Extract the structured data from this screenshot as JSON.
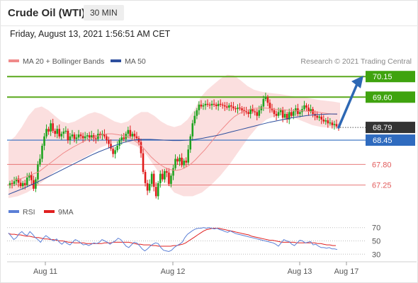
{
  "header": {
    "title": "Crude Oil (WTI)",
    "timeframe": "30 MIN"
  },
  "datetime": "Friday, August 13, 2021 1:56:51 AM CET",
  "legend": {
    "ma20_label": "MA 20 + Bollinger Bands",
    "ma50_label": "MA 50",
    "credit": "Research © 2021 Trading Central"
  },
  "rsi_legend": {
    "rsi_label": "RSI",
    "ma9_label": "9MA"
  },
  "colors": {
    "support": "#3a6fc4",
    "resistance": "#5aa81d",
    "target_box": "#3fa30f",
    "current_box": "#333333",
    "pivot": "#2f6bbf",
    "red_level": "#e25b5b",
    "bollinger": "#f9d4d4",
    "ma20": "#f08a8a",
    "ma50": "#2d4f9e",
    "candle_up": "#1ea31e",
    "candle_down": "#e01b1b",
    "rsi": "#5b7fd6",
    "rsi_ma9": "#e02020",
    "arrow": "#2d68b4"
  },
  "chart_data": [
    {
      "type": "candlestick",
      "title": "Crude Oil (WTI)",
      "timeframe": "30 MIN",
      "x_tick_labels": [
        "Aug 11",
        "Aug 12",
        "Aug 13",
        "Aug 17"
      ],
      "ylim": [
        66.9,
        70.4
      ],
      "grid": false,
      "legend_position": "top-left",
      "levels": [
        {
          "value": 70.15,
          "label": "70.15",
          "kind": "target"
        },
        {
          "value": 69.6,
          "label": "69.60",
          "kind": "resistance"
        },
        {
          "value": 68.79,
          "label": "68.79",
          "kind": "current"
        },
        {
          "value": 68.45,
          "label": "68.45",
          "kind": "pivot"
        },
        {
          "value": 67.8,
          "label": "67.80",
          "kind": "support"
        },
        {
          "value": 67.25,
          "label": "67.25",
          "kind": "support"
        }
      ],
      "closes": [
        67.3,
        67.28,
        67.35,
        67.42,
        67.31,
        67.22,
        67.3,
        67.25,
        67.45,
        67.52,
        67.38,
        67.15,
        67.4,
        67.8,
        67.95,
        68.3,
        68.55,
        68.75,
        68.68,
        68.9,
        68.7,
        68.62,
        68.75,
        68.55,
        68.62,
        68.68,
        68.7,
        68.45,
        68.55,
        68.6,
        68.48,
        68.52,
        68.6,
        68.56,
        68.5,
        68.55,
        68.58,
        68.52,
        68.58,
        68.5,
        68.48,
        68.62,
        68.58,
        68.62,
        68.55,
        68.45,
        68.35,
        68.22,
        68.08,
        68.18,
        68.3,
        68.45,
        68.52,
        68.48,
        68.62,
        68.72,
        68.55,
        68.62,
        68.55,
        68.5,
        68.4,
        68.1,
        67.6,
        67.3,
        67.1,
        67.28,
        67.55,
        67.2,
        66.95,
        67.3,
        67.55,
        67.4,
        67.62,
        67.58,
        67.28,
        67.5,
        67.7,
        67.95,
        67.88,
        67.98,
        67.78,
        67.9,
        67.85,
        68.2,
        68.55,
        68.9,
        69.1,
        69.25,
        69.4,
        69.35,
        69.38,
        69.42,
        69.4,
        69.38,
        69.42,
        69.4,
        69.36,
        69.42,
        69.4,
        69.38,
        69.35,
        69.32,
        69.38,
        69.35,
        69.3,
        69.28,
        69.32,
        69.3,
        69.25,
        69.22,
        69.2,
        69.15,
        69.28,
        69.22,
        69.2,
        69.1,
        69.25,
        69.35,
        69.55,
        69.6,
        69.45,
        69.3,
        69.25,
        69.15,
        69.1,
        69.2,
        69.25,
        69.05,
        69.15,
        69.0,
        69.2,
        69.1,
        69.22,
        69.3,
        69.15,
        69.2,
        69.28,
        69.38,
        69.32,
        69.22,
        69.28,
        69.15,
        69.1,
        69.05,
        69.08,
        69.0,
        68.95,
        68.98,
        68.9,
        68.92,
        68.85,
        68.88,
        68.82,
        68.79
      ],
      "ma20": [
        67.4,
        67.4,
        67.45,
        67.5,
        67.55,
        67.6,
        67.7,
        67.8,
        67.9,
        68.0,
        68.1,
        68.18,
        68.26,
        68.33,
        68.4,
        68.46,
        68.52,
        68.56,
        68.6,
        68.62,
        68.62,
        68.6,
        68.58,
        68.54,
        68.48,
        68.4,
        68.3,
        68.15,
        68.0,
        67.88,
        67.78,
        67.7,
        67.66,
        67.64,
        67.66,
        67.72,
        67.8,
        67.92,
        68.06,
        68.2,
        68.36,
        68.52,
        68.68,
        68.82,
        68.96,
        69.08,
        69.16,
        69.22,
        69.27,
        69.3,
        69.31,
        69.31,
        69.3,
        69.28,
        69.27,
        69.26,
        69.25,
        69.24,
        69.24,
        69.23,
        69.22,
        69.21,
        69.2,
        69.18,
        69.16,
        69.15,
        69.14
      ],
      "bollinger_upper": [
        68.4,
        68.55,
        68.8,
        69.1,
        69.3,
        69.35,
        69.25,
        69.1,
        68.95,
        68.9,
        68.95,
        69.05,
        69.15,
        69.2,
        69.15,
        69.05,
        68.95,
        68.9,
        68.95,
        69.1,
        69.2,
        69.2,
        69.1,
        68.95,
        68.85,
        68.8,
        68.85,
        69.0,
        69.25,
        69.6,
        69.8,
        69.95,
        70.1,
        70.2,
        70.18,
        70.05,
        69.9,
        69.8,
        69.75,
        69.72,
        69.7,
        69.68,
        69.65,
        69.62,
        69.6,
        69.58,
        69.55,
        69.52,
        69.5,
        69.48,
        69.45
      ],
      "bollinger_lower": [
        66.9,
        66.95,
        67.05,
        67.2,
        67.4,
        67.6,
        67.75,
        67.85,
        67.95,
        68.1,
        68.25,
        68.35,
        68.4,
        68.38,
        68.28,
        68.05,
        67.7,
        67.35,
        67.05,
        66.95,
        66.95,
        67.05,
        67.25,
        67.5,
        67.8,
        68.15,
        68.5,
        68.8,
        69.0,
        69.1,
        69.15,
        69.05,
        68.95,
        68.85,
        68.8,
        68.78,
        68.8
      ],
      "ma50": [
        67.0,
        67.08,
        67.16,
        67.25,
        67.34,
        67.44,
        67.54,
        67.64,
        67.74,
        67.84,
        67.94,
        68.04,
        68.13,
        68.21,
        68.29,
        68.36,
        68.42,
        68.46,
        68.47,
        68.47,
        68.46,
        68.45,
        68.44,
        68.44,
        68.45,
        68.47,
        68.5,
        68.54,
        68.58,
        68.63,
        68.68,
        68.73,
        68.78,
        68.83,
        68.88,
        68.93,
        68.97,
        69.01,
        69.05,
        69.08,
        69.11,
        69.13,
        69.14,
        69.15,
        69.15
      ]
    },
    {
      "type": "line",
      "title": "RSI",
      "series_names": [
        "RSI",
        "9MA"
      ],
      "ylim": [
        25,
        75
      ],
      "y_tick_labels": [
        "70",
        "50",
        "30"
      ],
      "rsi": [
        62,
        57,
        52,
        55,
        61,
        64,
        60,
        58,
        64,
        60,
        55,
        52,
        48,
        54,
        58,
        55,
        52,
        50,
        53,
        48,
        45,
        49,
        46,
        44,
        48,
        52,
        50,
        47,
        44,
        45,
        43,
        45,
        47,
        46,
        48,
        52,
        50,
        48,
        45,
        48,
        50,
        54,
        52,
        47,
        42,
        40,
        44,
        48,
        47,
        43,
        38,
        35,
        38,
        42,
        45,
        47,
        46,
        40,
        36,
        35,
        34,
        36,
        40,
        43,
        45,
        48,
        55,
        60,
        63,
        66,
        68,
        69,
        69,
        70,
        69,
        70,
        69,
        68,
        69,
        67,
        66,
        64,
        63,
        65,
        63,
        61,
        60,
        59,
        58,
        57,
        56,
        55,
        54,
        53,
        52,
        51,
        50,
        49,
        48,
        47,
        45,
        42,
        47,
        52,
        50,
        49,
        45,
        43,
        47,
        51,
        50,
        47,
        48,
        49,
        44,
        45,
        42,
        40,
        40,
        39,
        40,
        38,
        38,
        37
      ],
      "rsi_9ma": [
        61,
        60,
        60,
        59,
        59,
        58,
        57,
        57,
        56,
        55,
        55,
        54,
        53,
        53,
        52,
        52,
        51,
        50,
        50,
        49,
        48,
        48,
        47,
        47,
        47,
        47,
        46,
        46,
        46,
        46,
        46,
        46,
        47,
        47,
        47,
        48,
        48,
        48,
        48,
        48,
        48,
        47,
        46,
        45,
        45,
        44,
        44,
        44,
        43,
        43,
        42,
        42,
        42,
        42,
        42,
        43,
        43,
        44,
        45,
        47,
        50,
        53,
        56,
        59,
        62,
        65,
        67,
        68,
        69,
        69,
        69,
        68,
        67,
        66,
        65,
        64,
        63,
        62,
        61,
        60,
        59,
        57,
        56,
        55,
        54,
        53,
        52,
        51,
        51,
        50,
        49,
        48,
        48,
        48,
        48,
        48,
        47,
        47,
        47,
        47,
        47,
        47,
        47,
        46,
        46,
        45,
        44,
        44,
        43,
        43
      ]
    }
  ]
}
